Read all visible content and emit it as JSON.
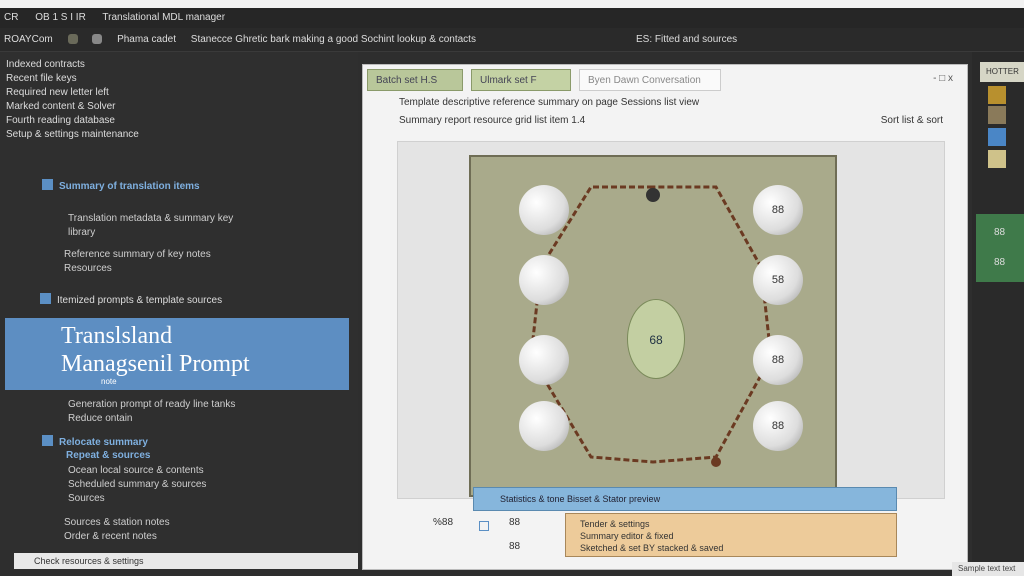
{
  "titlebar": {
    "items": [
      "CR",
      "OB 1 S I IR",
      "Translational MDL manager"
    ]
  },
  "menu": {
    "items": [
      "ROAYCom",
      "Phama cadet",
      "Stanecce Ghretic bark making a good Sochint lookup & contacts",
      "ES: Fitted and sources"
    ]
  },
  "left": {
    "list": [
      "Indexed contracts",
      "Recent file keys",
      "Required new letter left",
      "Marked content & Solver",
      "Fourth reading database",
      "Setup & settings maintenance"
    ],
    "sections": [
      {
        "title": "Summary of translation items",
        "lines": [
          "Translation metadata & summary key",
          "library"
        ],
        "extra": [
          "Reference summary of key notes",
          "Resources"
        ]
      },
      {
        "title": "Itemized prompts & template sources",
        "lines": []
      }
    ],
    "highlight": {
      "line1": "Translsland",
      "line2": "Managsenil Prompt",
      "sub": "note"
    },
    "after_highlight": [
      "Generation prompt of ready line tanks",
      "Reduce ontain"
    ],
    "section3": {
      "title": "Relocate summary",
      "sub": "Repeat & sources",
      "lines": [
        "Ocean local source & contents",
        "Scheduled summary & sources",
        "Sources"
      ]
    },
    "section4": {
      "lines": [
        "Sources & station notes",
        "Order & recent notes"
      ]
    },
    "bottombar": "Check resources & settings"
  },
  "center": {
    "tabs": [
      "Batch set H.S",
      "Ulmark set F",
      "Byen Dawn Conversation"
    ],
    "window_controls": "- □ x",
    "desc_line1": "Template descriptive reference summary on page Sessions list view",
    "desc_line2": "Summary report resource grid list item 1.4",
    "desc_right": "Sort list & sort",
    "balls_left": [
      "",
      "",
      "",
      ""
    ],
    "balls_right": [
      "88",
      "58",
      "88",
      "88"
    ],
    "center_label": "68",
    "left_labels": [
      "%88",
      "88",
      "88"
    ],
    "popup_blue": "Statistics & tone Bisset & Stator preview",
    "popup_tan": [
      "Tender & settings",
      "Summary editor & fixed",
      "Sketched & set BY stacked & saved"
    ]
  },
  "right": {
    "header": "HOTTER",
    "items": [
      "88",
      "88"
    ]
  },
  "status": "Sample text text"
}
